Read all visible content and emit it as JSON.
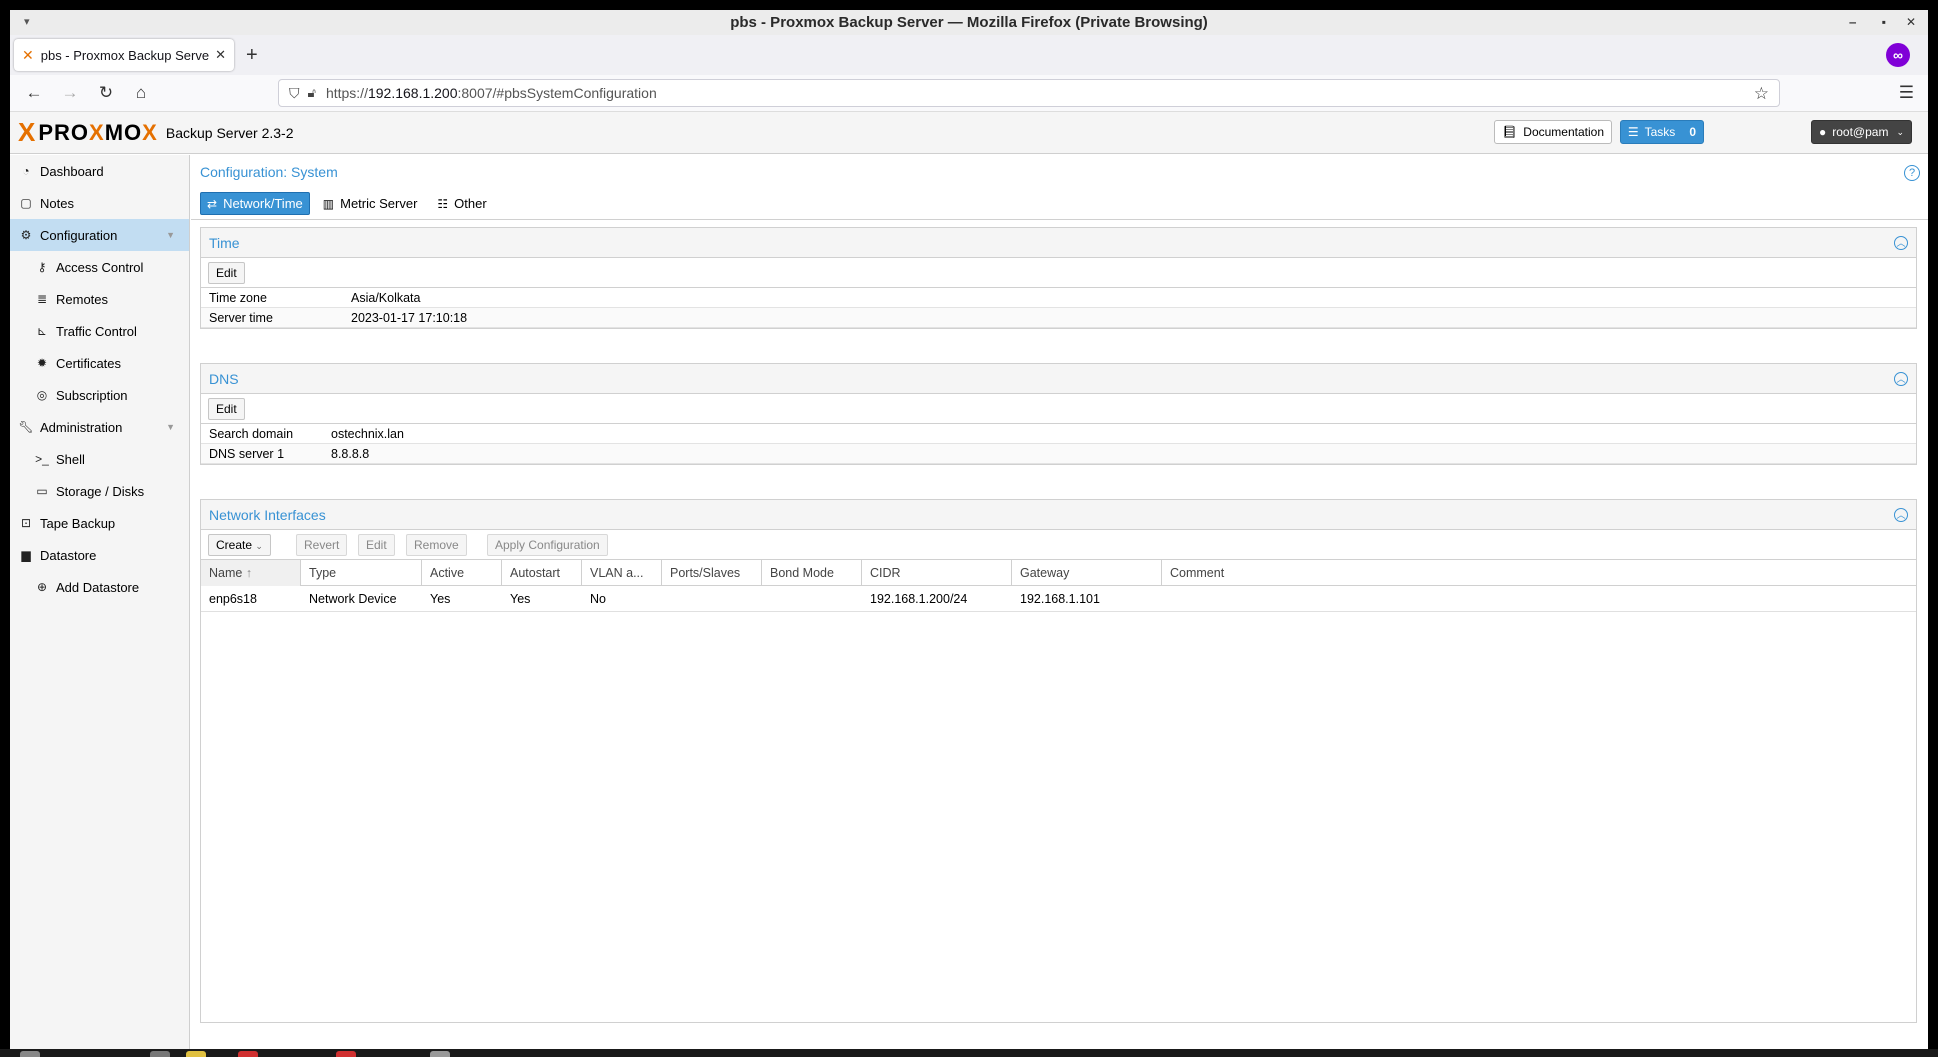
{
  "window": {
    "title": "pbs - Proxmox Backup Server — Mozilla Firefox (Private Browsing)",
    "minimize": "‒",
    "maximize": "▪",
    "close": "✕"
  },
  "browser": {
    "tab_title": "pbs - Proxmox Backup Serve",
    "new_tab": "+",
    "url_prefix": "https://",
    "url_host": "192.168.1.200",
    "url_rest": ":8007/#pbsSystemConfiguration"
  },
  "header": {
    "logo_x": "X",
    "logo_pro": "PRO",
    "logo_x2": "X",
    "logo_mo": "MO",
    "logo_x3": "X",
    "version": "Backup Server 2.3-2",
    "documentation": "Documentation",
    "tasks": "Tasks",
    "tasks_count": "0",
    "user": "root@pam"
  },
  "sidebar": {
    "items": [
      {
        "label": "Dashboard",
        "icon": "dashboard-icon"
      },
      {
        "label": "Notes",
        "icon": "notes-icon"
      },
      {
        "label": "Configuration",
        "icon": "gears-icon"
      },
      {
        "label": "Access Control",
        "icon": "key-icon"
      },
      {
        "label": "Remotes",
        "icon": "server-icon"
      },
      {
        "label": "Traffic Control",
        "icon": "chart-icon"
      },
      {
        "label": "Certificates",
        "icon": "certificate-icon"
      },
      {
        "label": "Subscription",
        "icon": "lifebuoy-icon"
      },
      {
        "label": "Administration",
        "icon": "wrench-icon"
      },
      {
        "label": "Shell",
        "icon": "terminal-icon"
      },
      {
        "label": "Storage / Disks",
        "icon": "hdd-icon"
      },
      {
        "label": "Tape Backup",
        "icon": "tape-icon"
      },
      {
        "label": "Datastore",
        "icon": "archive-icon"
      },
      {
        "label": "Add Datastore",
        "icon": "plus-circle-icon"
      }
    ]
  },
  "main": {
    "title": "Configuration: System",
    "tabs": [
      {
        "label": "Network/Time"
      },
      {
        "label": "Metric Server"
      },
      {
        "label": "Other"
      }
    ],
    "time": {
      "title": "Time",
      "edit": "Edit",
      "rows": [
        {
          "key": "Time zone",
          "value": "Asia/Kolkata"
        },
        {
          "key": "Server time",
          "value": "2023-01-17 17:10:18"
        }
      ]
    },
    "dns": {
      "title": "DNS",
      "edit": "Edit",
      "rows": [
        {
          "key": "Search domain",
          "value": "ostechnix.lan"
        },
        {
          "key": "DNS server 1",
          "value": "8.8.8.8"
        }
      ]
    },
    "network": {
      "title": "Network Interfaces",
      "toolbar": {
        "create": "Create",
        "revert": "Revert",
        "edit": "Edit",
        "remove": "Remove",
        "apply": "Apply Configuration"
      },
      "columns": [
        "Name",
        "Type",
        "Active",
        "Autostart",
        "VLAN a...",
        "Ports/Slaves",
        "Bond Mode",
        "CIDR",
        "Gateway",
        "Comment"
      ],
      "rows": [
        [
          "enp6s18",
          "Network Device",
          "Yes",
          "Yes",
          "No",
          "",
          "",
          "192.168.1.200/24",
          "192.168.1.101",
          ""
        ]
      ]
    }
  }
}
